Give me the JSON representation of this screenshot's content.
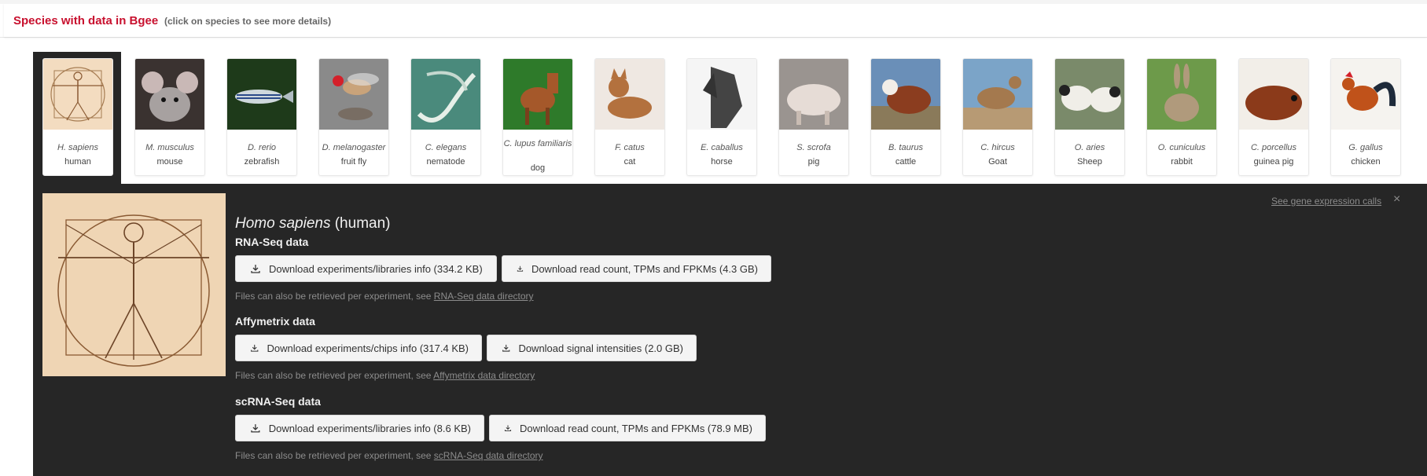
{
  "header": {
    "title": "Species with data in Bgee",
    "subtitle": "(click on species to see more details)"
  },
  "species": [
    {
      "sci": "H. sapiens",
      "common": "human",
      "icon": "vitruvian-man-image"
    },
    {
      "sci": "M. musculus",
      "common": "mouse",
      "icon": "mouse-image"
    },
    {
      "sci": "D. rerio",
      "common": "zebrafish",
      "icon": "zebrafish-image"
    },
    {
      "sci": "D. melanogaster",
      "common": "fruit fly",
      "icon": "fruit-fly-image"
    },
    {
      "sci": "C. elegans",
      "common": "nematode",
      "icon": "nematode-image"
    },
    {
      "sci": "C. lupus familiaris",
      "common": "dog",
      "icon": "dog-image"
    },
    {
      "sci": "F. catus",
      "common": "cat",
      "icon": "cat-image"
    },
    {
      "sci": "E. caballus",
      "common": "horse",
      "icon": "horse-image"
    },
    {
      "sci": "S. scrofa",
      "common": "pig",
      "icon": "pig-image"
    },
    {
      "sci": "B. taurus",
      "common": "cattle",
      "icon": "cattle-image"
    },
    {
      "sci": "C. hircus",
      "common": "Goat",
      "icon": "goat-image"
    },
    {
      "sci": "O. aries",
      "common": "Sheep",
      "icon": "sheep-image"
    },
    {
      "sci": "O. cuniculus",
      "common": "rabbit",
      "icon": "rabbit-image"
    },
    {
      "sci": "C. porcellus",
      "common": "guinea pig",
      "icon": "guinea-pig-image"
    },
    {
      "sci": "G. gallus",
      "common": "chicken",
      "icon": "chicken-image"
    }
  ],
  "detail": {
    "sci_name": "Homo sapiens",
    "common_name": "(human)",
    "calls_link": "See gene expression calls",
    "close": "×",
    "rnaseq": {
      "title": "RNA-Seq data",
      "btn1": "Download experiments/libraries info (334.2 KB)",
      "btn2": "Download read count, TPMs and FPKMs (4.3 GB)",
      "note": "Files can also be retrieved per experiment, see ",
      "link": "RNA-Seq data directory"
    },
    "affy": {
      "title": "Affymetrix data",
      "btn1": "Download experiments/chips info (317.4 KB)",
      "btn2": "Download signal intensities (2.0 GB)",
      "note": "Files can also be retrieved per experiment, see ",
      "link": "Affymetrix data directory"
    },
    "scrna": {
      "title": "scRNA-Seq data",
      "btn1": "Download experiments/libraries info (8.6 KB)",
      "btn2": "Download read count, TPMs and FPKMs (78.9 MB)",
      "note": "Files can also be retrieved per experiment, see ",
      "link": "scRNA-Seq data directory"
    }
  },
  "colors": {
    "title_red": "#c8102e",
    "panel_dark": "#262626"
  }
}
